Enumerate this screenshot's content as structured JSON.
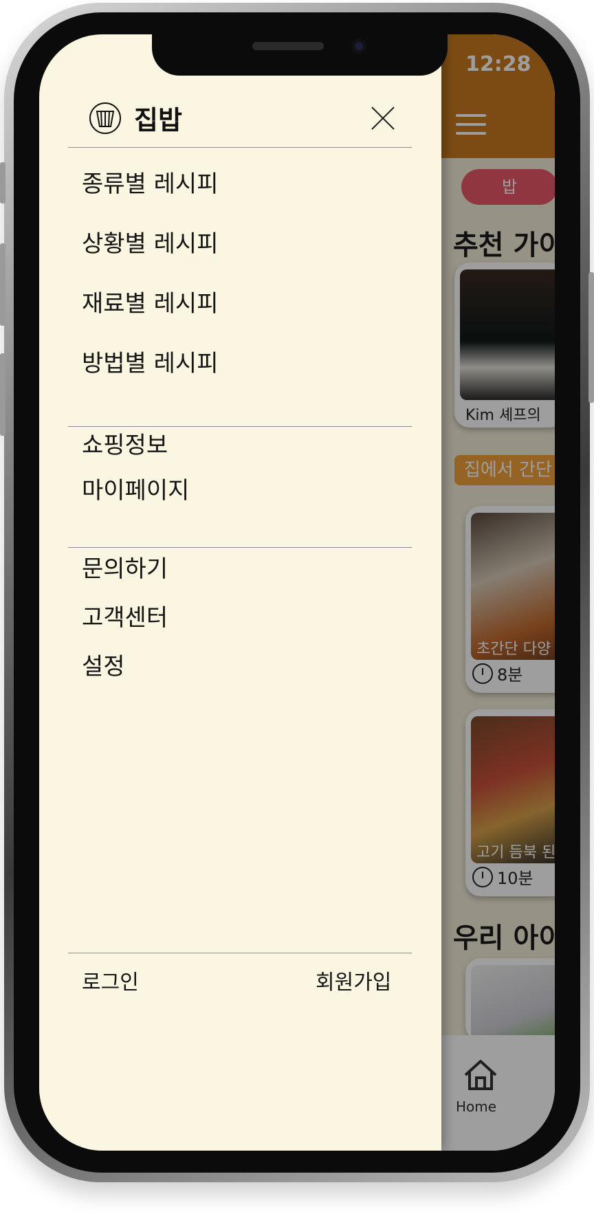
{
  "app": {
    "time": "12:28",
    "chip_label": "밥",
    "section_recommend": "추천 가이",
    "card1_caption": "Kim 셰프의",
    "promo_chip": "집에서 간단",
    "card2_caption": "초간단 다양",
    "card2_time": "8분",
    "card3_caption": "고기 듬북 된",
    "card3_time": "10분",
    "section_kids": "우리 아이",
    "tab_home_label": "Home"
  },
  "drawer": {
    "brand_name": "집밥",
    "recipe_menu": [
      {
        "label": "종류별 레시피"
      },
      {
        "label": "상황별 레시피"
      },
      {
        "label": "재료별 레시피"
      },
      {
        "label": "방법별 레시피"
      }
    ],
    "account_menu": [
      {
        "label": "쇼핑정보"
      },
      {
        "label": "마이페이지"
      }
    ],
    "support_menu": [
      {
        "label": "문의하기"
      },
      {
        "label": "고객센터"
      },
      {
        "label": "설정"
      }
    ],
    "login_label": "로그인",
    "signup_label": "회원가입"
  },
  "colors": {
    "header": "#c77a1f",
    "drawer_bg": "#fbf6e2",
    "chip_red": "#e7586a",
    "chip_orange": "#f0a23a"
  }
}
